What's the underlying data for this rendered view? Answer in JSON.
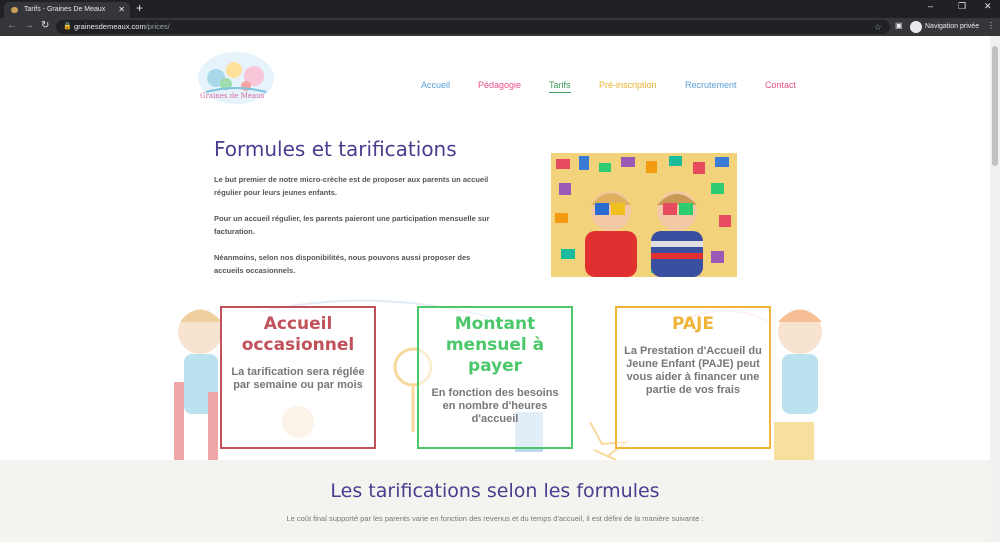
{
  "browser": {
    "tab_title": "Tarifs - Graines De Meaux",
    "url_domain": "grainesdemeaux.com",
    "url_path": "/prices/",
    "private_label": "Navigation privée"
  },
  "site": {
    "logo_text": "Graines de Meaux",
    "nav": [
      "Accueil",
      "Pédagogie",
      "Tarifs",
      "Pré-inscription",
      "Recrutement",
      "Contact"
    ]
  },
  "intro": {
    "title": "Formules et tarifications",
    "para1": "Le but premier de notre micro-crèche est de proposer aux parents un accueil régulier pour leurs jeunes enfants.",
    "para2": "Pour  un accueil régulier, les parents paieront une participation mensuelle sur facturation.",
    "para3": "Néanmoins, selon nos disponibilités, nous pouvons aussi proposer des accueils occasionnels."
  },
  "cards": [
    {
      "title": "Accueil occasionnel",
      "text": "La tarification sera réglée par semaine ou par mois",
      "color": "#c0505a"
    },
    {
      "title": "Montant mensuel à payer",
      "text": "En fonction des besoins en nombre d'heures d'accueil",
      "color": "#4cc86a"
    },
    {
      "title": "PAJE",
      "text": "La Prestation d'Accueil du Jeune Enfant (PAJE) peut vous aider à financer une partie de vos frais",
      "color": "#f0b43a"
    }
  ],
  "section2": {
    "title": "Les tarifications selon les formules",
    "text": "Le coût final supporté par les parents varie en fonction des revenus et du temps d'accueil, il est défini de la manière suivante :"
  }
}
